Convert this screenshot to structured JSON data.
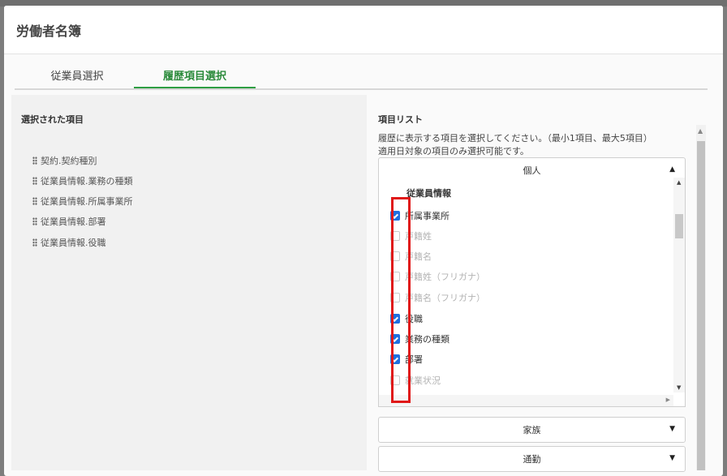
{
  "dialog": {
    "title": "労働者名簿"
  },
  "tabs": [
    {
      "label": "従業員選択",
      "active": false
    },
    {
      "label": "履歴項目選択",
      "active": true
    }
  ],
  "selected_panel": {
    "heading": "選択された項目",
    "items": [
      "契約.契約種別",
      "従業員情報.業務の種類",
      "従業員情報.所属事業所",
      "従業員情報.部署",
      "従業員情報.役職"
    ]
  },
  "item_list": {
    "heading": "項目リスト",
    "hint_line1": "履歴に表示する項目を選択してください。（最小1項目、最大5項目）",
    "hint_line2": "適用日対象の項目のみ選択可能です。",
    "sections": [
      {
        "label": "個人",
        "expanded": true,
        "group_label": "従業員情報",
        "items": [
          {
            "label": "所属事業所",
            "checked": true
          },
          {
            "label": "戸籍姓",
            "checked": false
          },
          {
            "label": "戸籍名",
            "checked": false
          },
          {
            "label": "戸籍姓（フリガナ）",
            "checked": false
          },
          {
            "label": "戸籍名（フリガナ）",
            "checked": false
          },
          {
            "label": "役職",
            "checked": true
          },
          {
            "label": "業務の種類",
            "checked": true
          },
          {
            "label": "部署",
            "checked": true
          },
          {
            "label": "就業状況",
            "checked": false
          }
        ]
      },
      {
        "label": "家族",
        "expanded": false
      },
      {
        "label": "通勤",
        "expanded": false
      }
    ]
  },
  "colors": {
    "accent_green": "#2e9e43",
    "checkbox_blue": "#1f6fe0",
    "highlight_red": "#e01818"
  }
}
